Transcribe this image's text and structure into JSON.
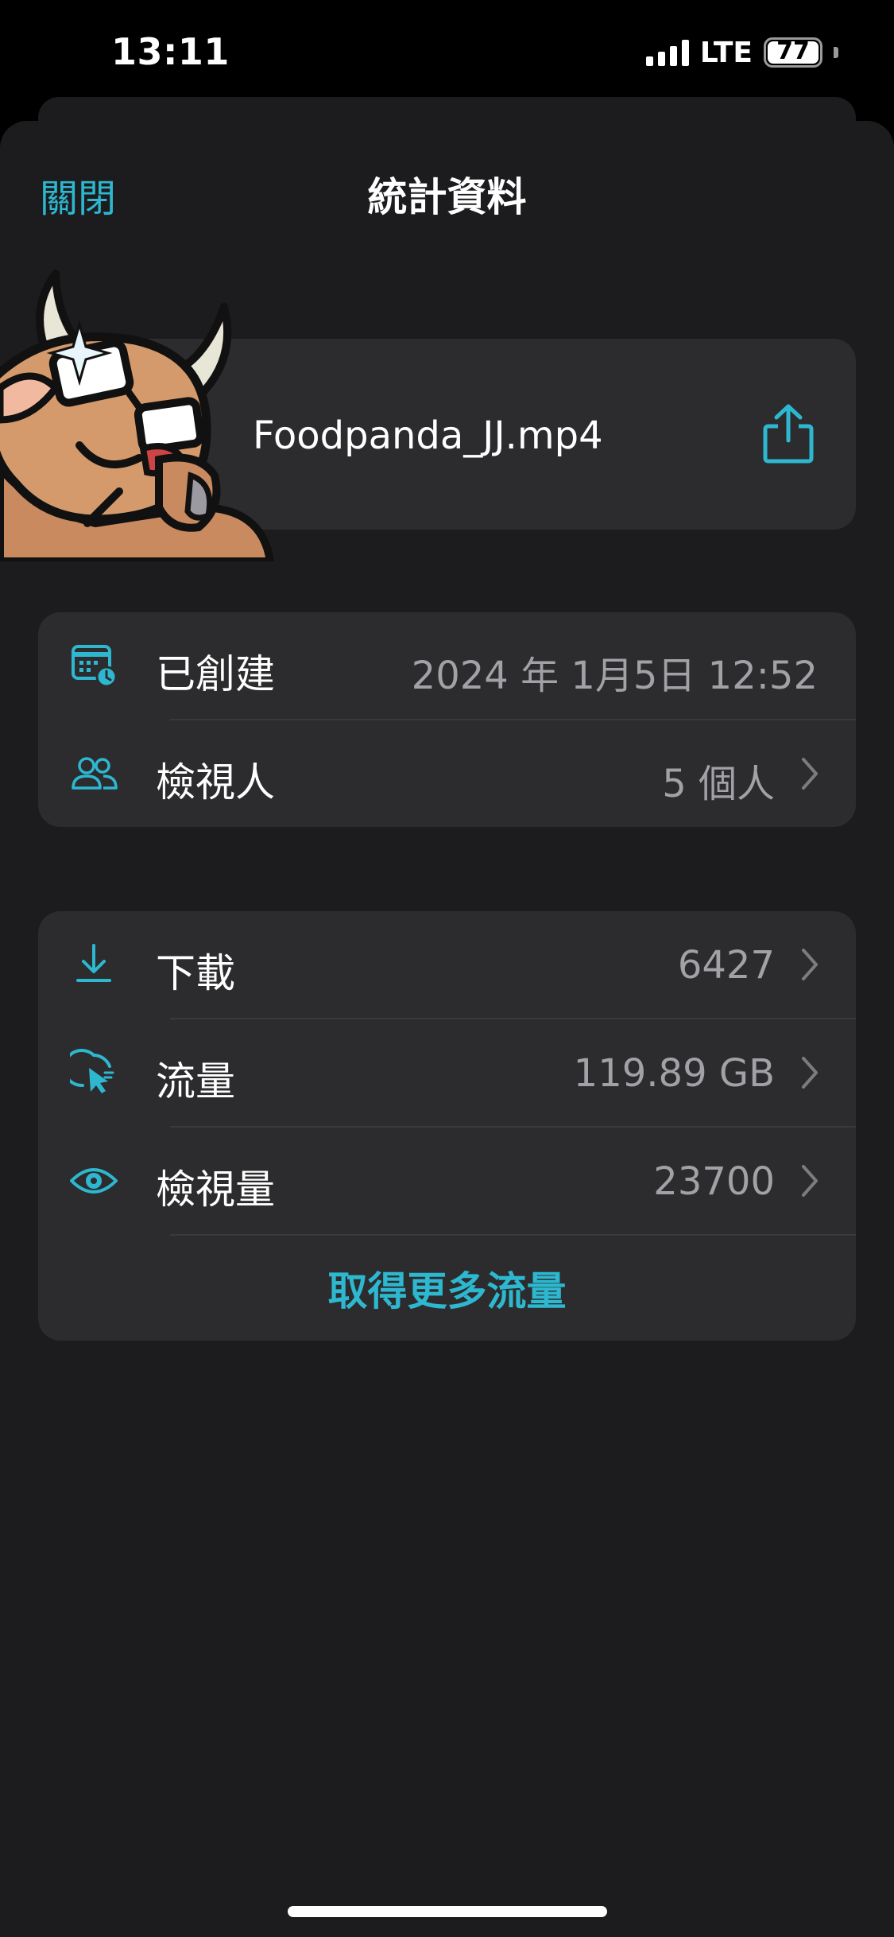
{
  "status_bar": {
    "time": "13:11",
    "network": "LTE",
    "battery_level": "77",
    "icons": [
      "signal-bars-icon",
      "battery-icon"
    ]
  },
  "nav": {
    "close_label": "關閉",
    "title": "統計資料"
  },
  "file": {
    "name": "Foodpanda_JJ.mp4",
    "share_icon": "share-icon",
    "sticker": "bull-with-glasses-sticker"
  },
  "info": {
    "created_label": "已創建",
    "created_value": "2024 年 1月5日 12:52",
    "created_icon": "calendar-clock-icon",
    "viewers_label": "檢視人",
    "viewers_value": "5 個人",
    "viewers_icon": "people-icon"
  },
  "stats": {
    "downloads_label": "下載",
    "downloads_value": "6427",
    "downloads_icon": "download-icon",
    "traffic_label": "流量",
    "traffic_value": "119.89 GB",
    "traffic_icon": "cursor-click-icon",
    "views_label": "檢視量",
    "views_value": "23700",
    "views_icon": "eye-icon",
    "more_button": "取得更多流量"
  },
  "colors": {
    "accent": "#2db8d0",
    "background": "#1c1c1e",
    "card": "#2c2c2e",
    "secondary_text": "#a1a1a6"
  }
}
